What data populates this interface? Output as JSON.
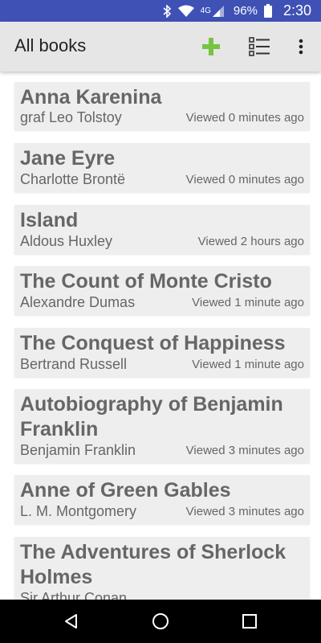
{
  "status_bar": {
    "network": "4G",
    "battery": "96%",
    "time": "2:30",
    "icons": [
      "bluetooth-icon",
      "wifi-icon",
      "signal-icon",
      "battery-icon"
    ]
  },
  "app_bar": {
    "title": "All books",
    "actions": [
      "add-icon",
      "list-view-icon",
      "more-vert-icon"
    ],
    "accent_color": "#76c442"
  },
  "books": [
    {
      "title": "Anna Karenina",
      "author": "graf Leo Tolstoy",
      "viewed": "Viewed 0 minutes ago"
    },
    {
      "title": "Jane Eyre",
      "author": "Charlotte Brontë",
      "viewed": "Viewed 0 minutes ago"
    },
    {
      "title": "Island",
      "author": "Aldous Huxley",
      "viewed": "Viewed 2 hours ago"
    },
    {
      "title": "The Count of Monte Cristo",
      "author": "Alexandre Dumas",
      "viewed": "Viewed 1 minute ago"
    },
    {
      "title": "The Conquest of Happiness",
      "author": "Bertrand Russell",
      "viewed": "Viewed 1 minute ago"
    },
    {
      "title": "Autobiography of Benjamin Franklin",
      "author": "Benjamin Franklin",
      "viewed": "Viewed 3 minutes ago"
    },
    {
      "title": "Anne of Green Gables",
      "author": "L. M. Montgomery",
      "viewed": "Viewed 3 minutes ago"
    },
    {
      "title": "The Adventures of Sherlock Holmes",
      "author": "Sir Arthur Conan",
      "viewed": ""
    }
  ],
  "nav_bar": {
    "buttons": [
      "back-icon",
      "home-icon",
      "recent-apps-icon"
    ]
  }
}
